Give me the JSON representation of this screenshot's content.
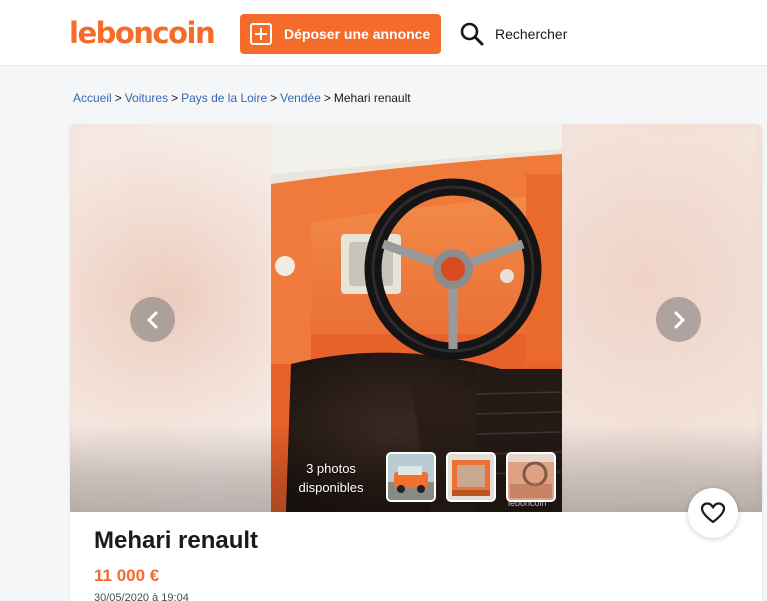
{
  "header": {
    "logo": "leboncoin",
    "post_button_label": "Déposer une annonce",
    "search_label": "Rechercher"
  },
  "breadcrumb": [
    "Accueil",
    "Voitures",
    "Pays de la Loire",
    "Vendée"
  ],
  "breadcrumb_current": "Mehari renault",
  "gallery": {
    "photo_count_line1": "3 photos",
    "photo_count_line2": "disponibles",
    "watermark": "leboncoin",
    "icons": [
      "chevron-left-icon",
      "chevron-right-icon",
      "heart-icon",
      "search-icon",
      "plus-square-icon"
    ]
  },
  "listing": {
    "title": "Mehari renault",
    "price": "11 000 €",
    "date": "30/05/2020 à 19:04"
  },
  "colors": {
    "brand": "#f56b2a",
    "link": "#3a68b0",
    "text": "#1a1a1a",
    "page_bg": "#f4f6f7"
  }
}
